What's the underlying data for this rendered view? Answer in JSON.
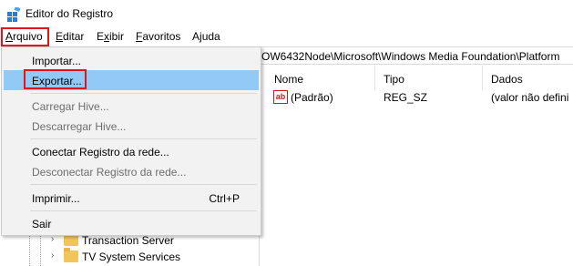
{
  "window": {
    "title": "Editor do Registro",
    "icon": "regedit-icon"
  },
  "menubar": [
    {
      "label": "Arquivo",
      "mnemonic": "A",
      "rest": "rquivo"
    },
    {
      "label": "Editar",
      "mnemonic": "E",
      "rest": "ditar"
    },
    {
      "label": "Exibir",
      "mnemonic": "x",
      "pre": "E",
      "rest": "ibir"
    },
    {
      "label": "Favoritos",
      "mnemonic": "F",
      "rest": "avoritos"
    },
    {
      "label": "Ajuda",
      "mnemonic": "j",
      "pre": "A",
      "rest": "uda"
    }
  ],
  "address": {
    "path": "OW6432Node\\Microsoft\\Windows Media Foundation\\Platform"
  },
  "listview": {
    "columns": [
      "Nome",
      "Tipo",
      "Dados"
    ],
    "rows": [
      {
        "name": "(Padrão)",
        "type": "REG_SZ",
        "data": "(valor não defini"
      }
    ]
  },
  "tree": {
    "items": [
      {
        "label": "Transaction Server",
        "icon": "folder-icon"
      },
      {
        "label": "TV System Services",
        "icon": "folder-icon"
      }
    ]
  },
  "file_menu": {
    "items": [
      {
        "label": "Importar...",
        "enabled": true
      },
      {
        "label": "Exportar...",
        "enabled": true,
        "selected": true
      },
      {
        "label": "Carregar Hive...",
        "enabled": false
      },
      {
        "label": "Descarregar Hive...",
        "enabled": false
      },
      {
        "label": "Conectar Registro da rede...",
        "enabled": true
      },
      {
        "label": "Desconectar Registro da rede...",
        "enabled": false
      },
      {
        "label": "Imprimir...",
        "enabled": true,
        "shortcut": "Ctrl+P"
      },
      {
        "label": "Sair",
        "enabled": true
      }
    ]
  },
  "colors": {
    "highlight_border": "#e3131b",
    "selected_item": "#91c9f7",
    "menu_bg": "#f2f2f2",
    "folder": "#f2c55c"
  }
}
